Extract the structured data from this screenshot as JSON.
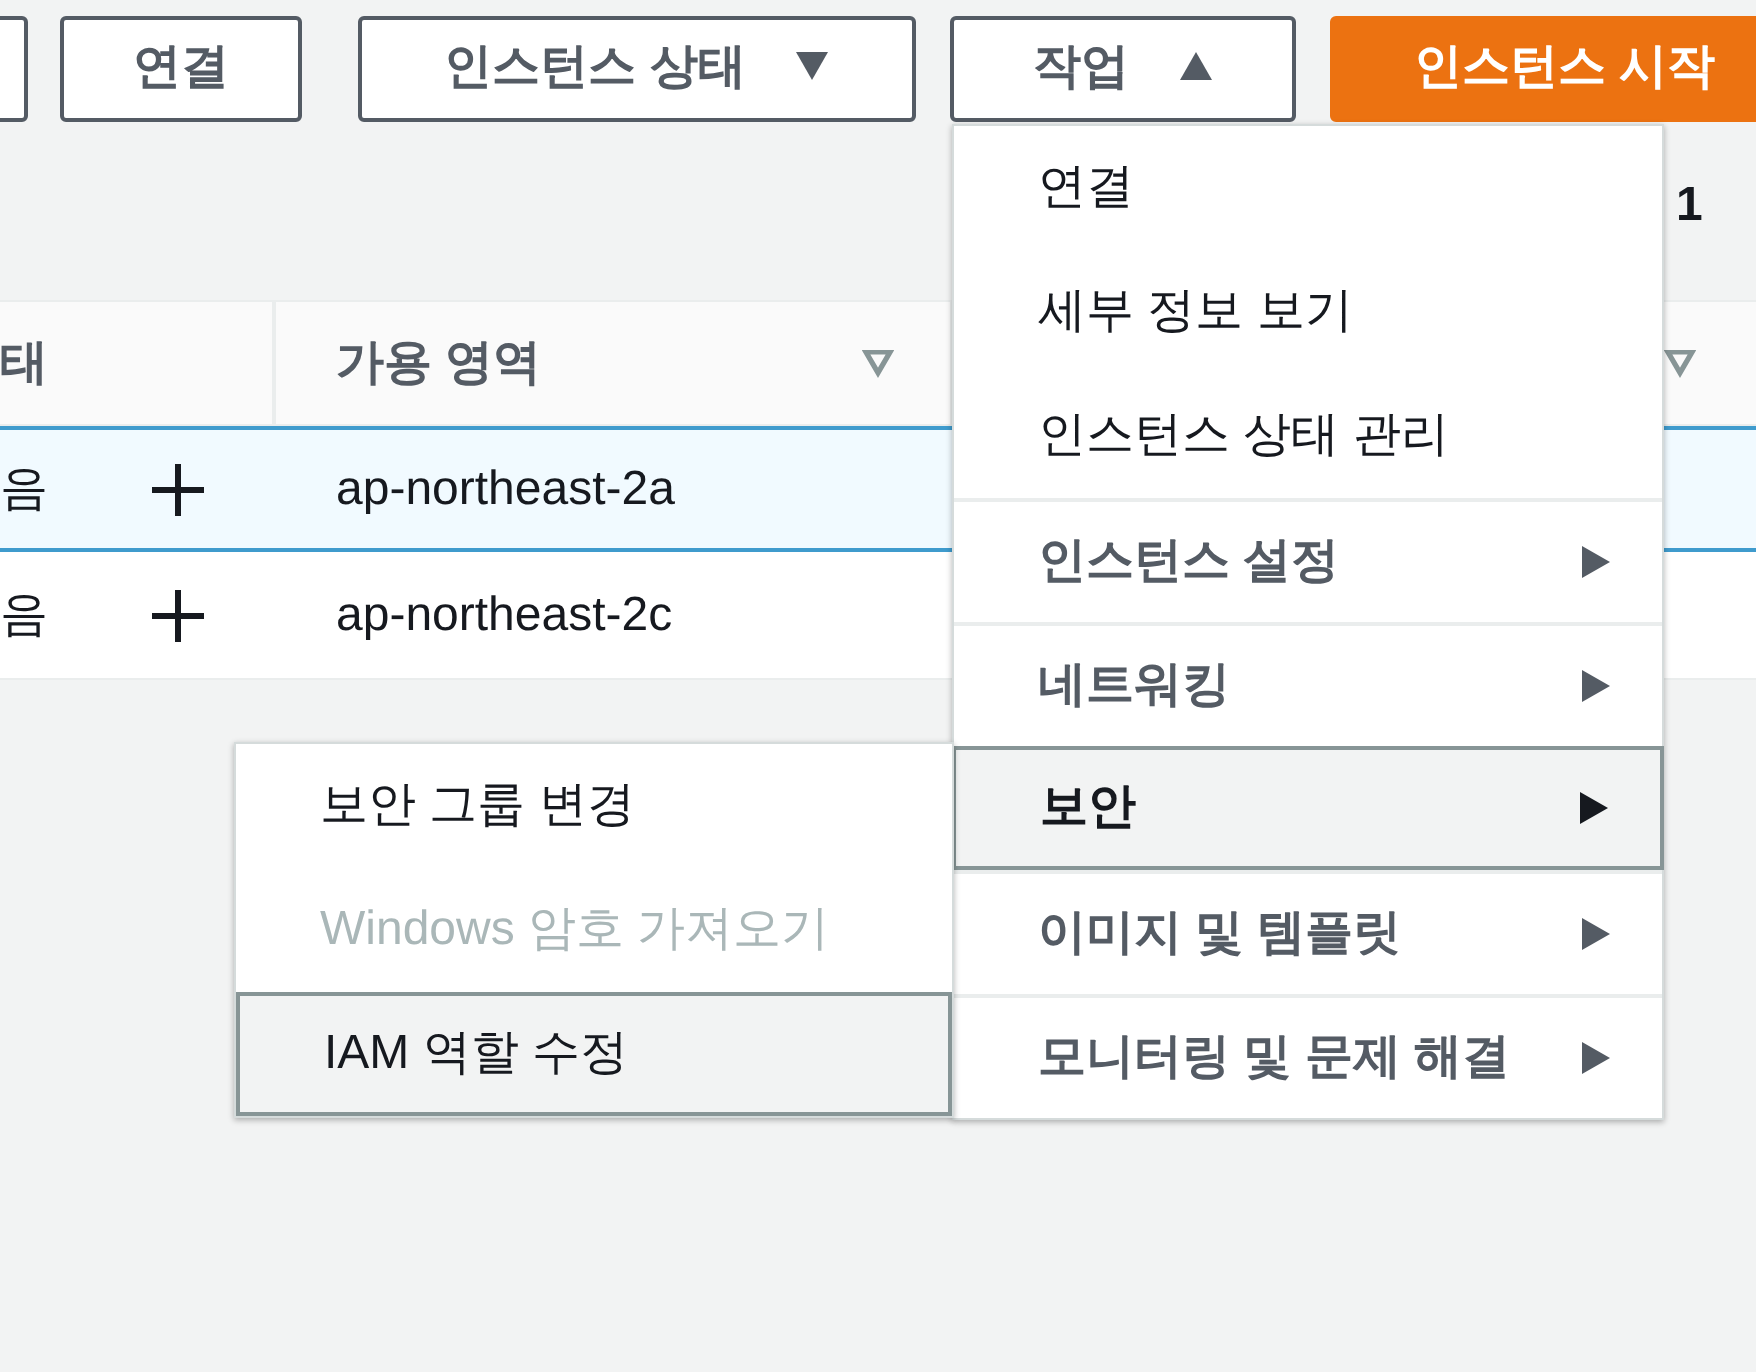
{
  "toolbar": {
    "buttons": [
      {
        "label": "연결",
        "kind": "plain"
      },
      {
        "label": "인스턴스 상태",
        "kind": "dropdown",
        "expanded": false
      },
      {
        "label": "작업",
        "kind": "dropdown",
        "expanded": true
      },
      {
        "label": "인스턴스 시작",
        "kind": "primary"
      }
    ]
  },
  "pagination": {
    "page": "1"
  },
  "table": {
    "columns": [
      {
        "label": "태",
        "filter": false
      },
      {
        "label": "가용 영역",
        "filter": true
      },
      {
        "filter": true
      }
    ],
    "rows": [
      {
        "selected": true,
        "cells": [
          "음",
          "ap-northeast-2a"
        ]
      },
      {
        "selected": false,
        "cells": [
          "음",
          "ap-northeast-2c"
        ]
      }
    ]
  },
  "actions_menu": {
    "items": [
      {
        "label": "연결",
        "kind": "action",
        "selected": false
      },
      {
        "label": "세부 정보 보기",
        "kind": "action",
        "selected": false
      },
      {
        "label": "인스턴스 상태 관리",
        "kind": "action",
        "selected": false
      },
      {
        "label": "인스턴스 설정",
        "kind": "submenu",
        "selected": false
      },
      {
        "label": "네트워킹",
        "kind": "submenu",
        "selected": false
      },
      {
        "label": "보안",
        "kind": "submenu",
        "selected": true
      },
      {
        "label": "이미지 및 템플릿",
        "kind": "submenu",
        "selected": false
      },
      {
        "label": "모니터링 및 문제 해결",
        "kind": "submenu",
        "selected": false
      }
    ]
  },
  "submenu": {
    "items": [
      {
        "label": "보안 그룹 변경",
        "disabled": false,
        "selected": false
      },
      {
        "label": "Windows 암호 가져오기",
        "disabled": true,
        "selected": false
      },
      {
        "label": "IAM 역할 수정",
        "disabled": false,
        "selected": true
      }
    ]
  }
}
